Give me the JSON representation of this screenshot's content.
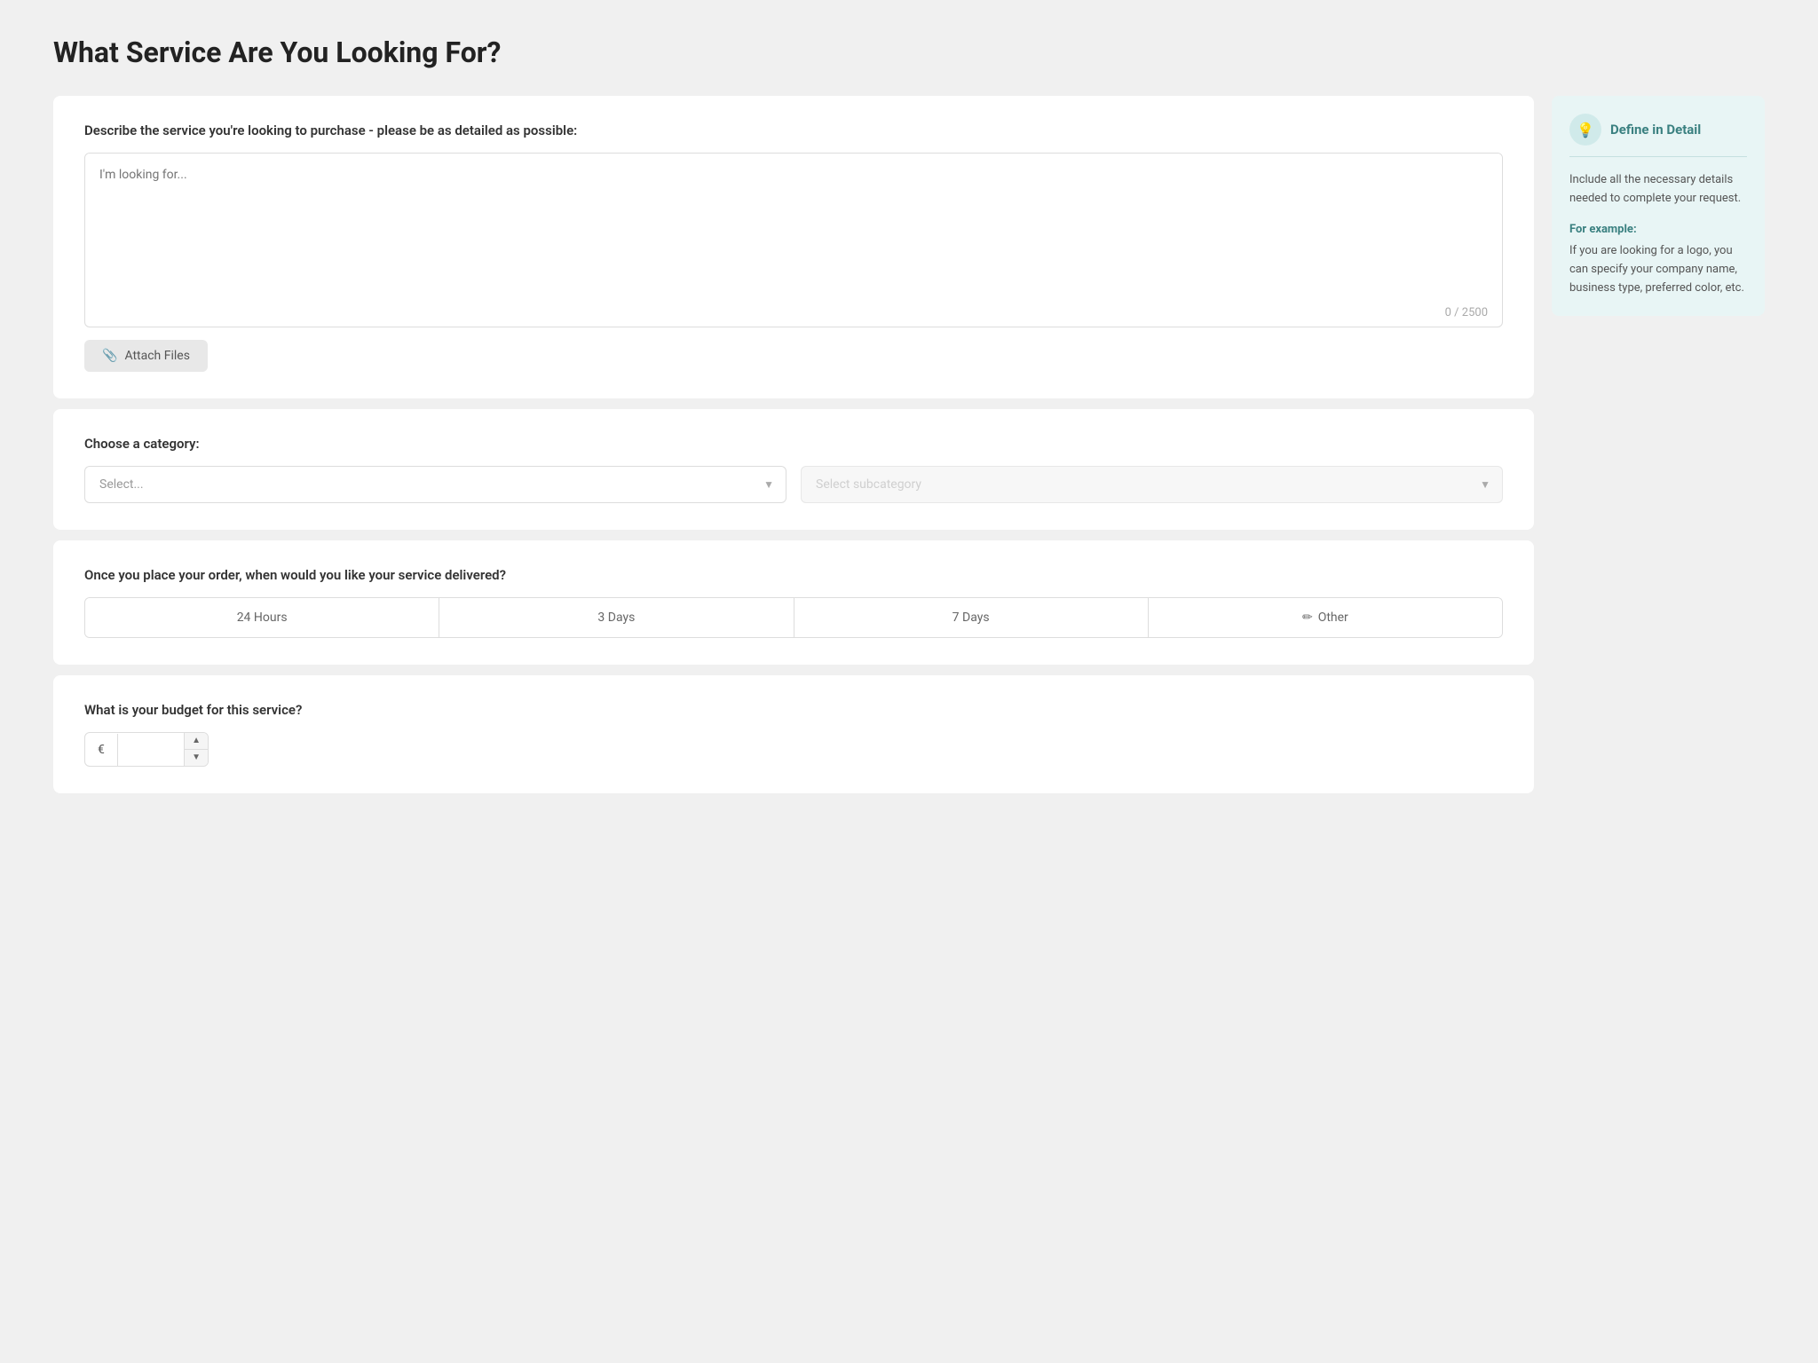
{
  "page": {
    "title": "What Service Are You Looking For?"
  },
  "describe_section": {
    "label": "Describe the service you're looking to purchase - please be as detailed as possible:",
    "textarea_placeholder": "I'm looking for...",
    "char_count": "0 / 2500"
  },
  "attach": {
    "label": "Attach Files"
  },
  "category_section": {
    "label": "Choose a category:",
    "select_placeholder": "Select...",
    "subcategory_placeholder": "Select subcategory"
  },
  "delivery_section": {
    "label": "Once you place your order, when would you like your service delivered?",
    "options": [
      {
        "value": "24h",
        "label": "24 Hours"
      },
      {
        "value": "3d",
        "label": "3 Days"
      },
      {
        "value": "7d",
        "label": "7 Days"
      },
      {
        "value": "other",
        "label": "Other",
        "icon": "✏"
      }
    ]
  },
  "budget_section": {
    "label": "What is your budget for this service?",
    "currency_symbol": "€"
  },
  "info_panel": {
    "title": "Define in Detail",
    "icon": "💡",
    "body": "Include all the necessary details needed to complete your request.",
    "example_label": "For example:",
    "example_text": "If you are looking for a logo, you can specify your company name, business type, preferred color, etc."
  }
}
